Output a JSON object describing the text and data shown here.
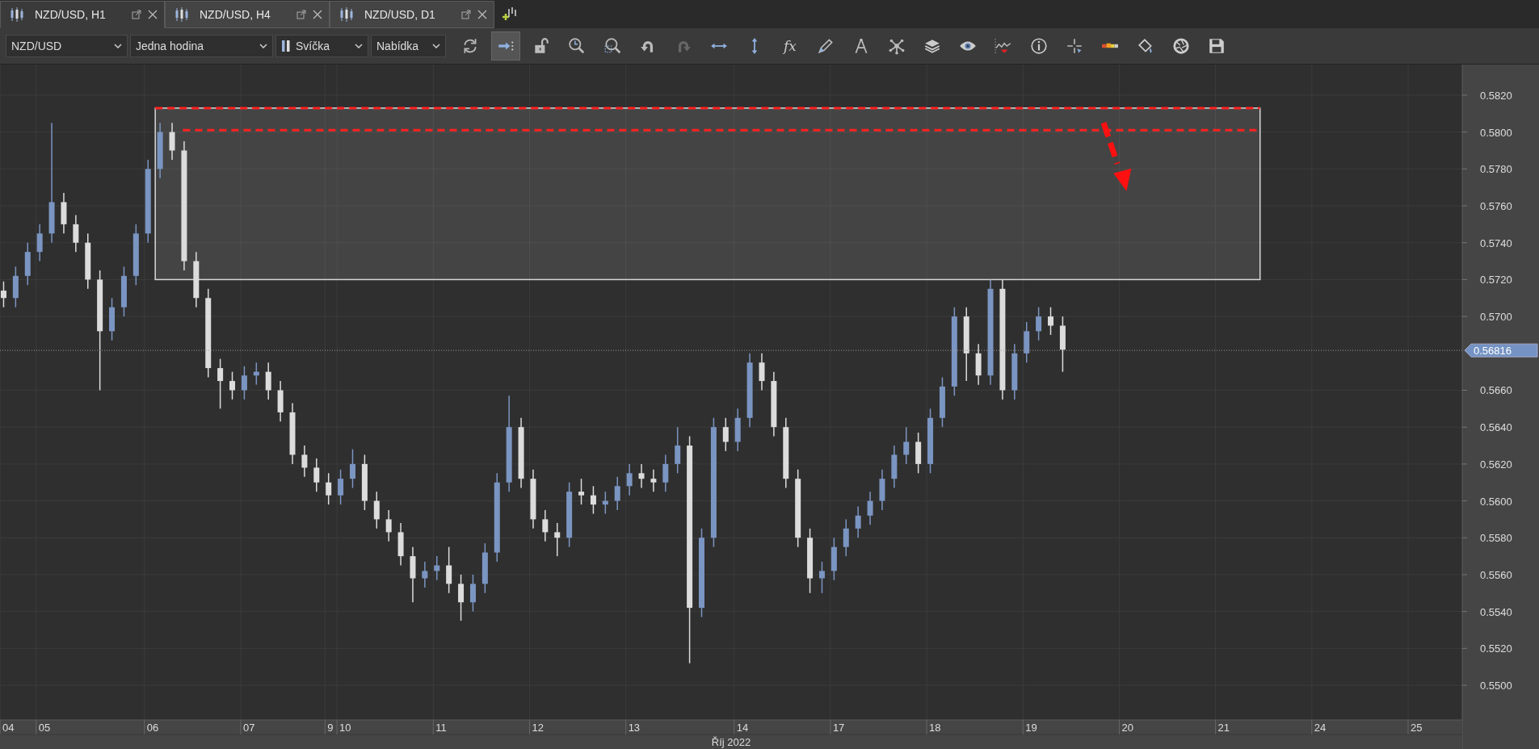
{
  "tabs": [
    {
      "label": "NZD/USD, H1",
      "selected": true
    },
    {
      "label": "NZD/USD, H4",
      "selected": false
    },
    {
      "label": "NZD/USD, D1",
      "selected": false
    }
  ],
  "toolbar": {
    "dropdowns": [
      {
        "value": "NZD/USD",
        "kind": "plain"
      },
      {
        "value": "Jedna hodina",
        "kind": "plain"
      },
      {
        "value": "Svíčka",
        "kind": "candle"
      },
      {
        "value": "Nabídka",
        "kind": "plain"
      }
    ],
    "buttons": [
      {
        "selected": false,
        "disabled": false
      },
      {
        "selected": true,
        "disabled": false
      },
      {
        "selected": false,
        "disabled": false
      },
      {
        "selected": false,
        "disabled": false
      },
      {
        "selected": false,
        "disabled": false
      },
      {
        "selected": false,
        "disabled": false
      },
      {
        "selected": false,
        "disabled": true
      },
      {
        "selected": false,
        "disabled": false
      },
      {
        "selected": false,
        "disabled": false
      },
      {
        "selected": false,
        "disabled": false,
        "label": "fx"
      },
      {
        "selected": false,
        "disabled": false
      },
      {
        "selected": false,
        "disabled": false
      },
      {
        "selected": false,
        "disabled": false
      },
      {
        "selected": false,
        "disabled": false
      },
      {
        "selected": false,
        "disabled": false
      },
      {
        "selected": false,
        "disabled": false
      },
      {
        "selected": false,
        "disabled": false
      },
      {
        "selected": false,
        "disabled": false
      },
      {
        "selected": false,
        "disabled": false
      },
      {
        "selected": false,
        "disabled": false
      },
      {
        "selected": false,
        "disabled": false
      },
      {
        "selected": false,
        "disabled": false
      }
    ]
  },
  "chart": {
    "chart_data": {
      "type": "candlestick",
      "xlabel": "Říj 2022",
      "grid": true,
      "ylim": [
        0.54812,
        0.58366
      ],
      "yticks": [
        {
          "value": 0.582,
          "label": "0.5820"
        },
        {
          "value": 0.58,
          "label": "0.5800"
        },
        {
          "value": 0.578,
          "label": "0.5780"
        },
        {
          "value": 0.576,
          "label": "0.5760"
        },
        {
          "value": 0.574,
          "label": "0.5740"
        },
        {
          "value": 0.572,
          "label": "0.5720"
        },
        {
          "value": 0.57,
          "label": "0.5700"
        },
        {
          "value": 0.566,
          "label": "0.5660"
        },
        {
          "value": 0.564,
          "label": "0.5640"
        },
        {
          "value": 0.562,
          "label": "0.5620"
        },
        {
          "value": 0.56,
          "label": "0.5600"
        },
        {
          "value": 0.558,
          "label": "0.5580"
        },
        {
          "value": 0.556,
          "label": "0.5560"
        },
        {
          "value": 0.554,
          "label": "0.5540"
        },
        {
          "value": 0.552,
          "label": "0.5520"
        },
        {
          "value": 0.55,
          "label": "0.5500"
        }
      ],
      "categories": [
        "04",
        null,
        null,
        "05",
        null,
        null,
        null,
        null,
        null,
        null,
        null,
        null,
        "06",
        null,
        null,
        null,
        null,
        null,
        null,
        null,
        "07",
        null,
        null,
        null,
        null,
        null,
        null,
        "9",
        "10",
        null,
        null,
        null,
        null,
        null,
        null,
        null,
        "11",
        null,
        null,
        null,
        null,
        null,
        null,
        null,
        "12",
        null,
        null,
        null,
        null,
        null,
        null,
        null,
        "13",
        null,
        null,
        null,
        null,
        null,
        null,
        null,
        null,
        "14",
        null,
        null,
        null,
        null,
        null,
        null,
        null,
        "17",
        null,
        null,
        null,
        null,
        null,
        null,
        null,
        "18",
        null,
        null,
        null,
        null,
        null,
        null,
        null,
        "19",
        null,
        null,
        null,
        null,
        null,
        null,
        null,
        "20",
        null,
        null,
        null,
        null,
        null,
        null,
        null,
        "21",
        null,
        null,
        null,
        null,
        null,
        null,
        null,
        "24",
        null,
        null,
        null,
        null,
        null,
        null,
        null,
        "25",
        null,
        null,
        null
      ],
      "ohlc": [
        [
          0.5714,
          0.5719,
          0.5705,
          0.571
        ],
        [
          0.571,
          0.5727,
          0.5705,
          0.5722
        ],
        [
          0.5722,
          0.574,
          0.5717,
          0.5735
        ],
        [
          0.5735,
          0.575,
          0.573,
          0.5745
        ],
        [
          0.5745,
          0.5805,
          0.574,
          0.5762
        ],
        [
          0.5762,
          0.5767,
          0.5745,
          0.575
        ],
        [
          0.575,
          0.5755,
          0.5735,
          0.574
        ],
        [
          0.574,
          0.5745,
          0.5715,
          0.572
        ],
        [
          0.572,
          0.5725,
          0.566,
          0.5692
        ],
        [
          0.5692,
          0.571,
          0.5687,
          0.5705
        ],
        [
          0.5705,
          0.5727,
          0.57,
          0.5722
        ],
        [
          0.5722,
          0.575,
          0.5717,
          0.5745
        ],
        [
          0.5745,
          0.5785,
          0.574,
          0.578
        ],
        [
          0.578,
          0.5805,
          0.5775,
          0.58
        ],
        [
          0.58,
          0.5805,
          0.5785,
          0.579
        ],
        [
          0.579,
          0.5795,
          0.5725,
          0.573
        ],
        [
          0.573,
          0.5735,
          0.5705,
          0.571
        ],
        [
          0.571,
          0.5715,
          0.5667,
          0.5672
        ],
        [
          0.5672,
          0.5677,
          0.565,
          0.5665
        ],
        [
          0.5665,
          0.567,
          0.5655,
          0.566
        ],
        [
          0.566,
          0.5673,
          0.5655,
          0.5668
        ],
        [
          0.5668,
          0.5675,
          0.5663,
          0.567
        ],
        [
          0.567,
          0.5675,
          0.5655,
          0.566
        ],
        [
          0.566,
          0.5665,
          0.5643,
          0.5648
        ],
        [
          0.5648,
          0.5653,
          0.562,
          0.5625
        ],
        [
          0.5625,
          0.563,
          0.5613,
          0.5618
        ],
        [
          0.5618,
          0.5623,
          0.5605,
          0.561
        ],
        [
          0.561,
          0.5615,
          0.5598,
          0.5603
        ],
        [
          0.5603,
          0.5617,
          0.5598,
          0.5612
        ],
        [
          0.5612,
          0.5628,
          0.5607,
          0.562
        ],
        [
          0.562,
          0.5625,
          0.5595,
          0.56
        ],
        [
          0.56,
          0.5605,
          0.5585,
          0.559
        ],
        [
          0.559,
          0.5595,
          0.5578,
          0.5583
        ],
        [
          0.5583,
          0.5588,
          0.5565,
          0.557
        ],
        [
          0.557,
          0.5575,
          0.5545,
          0.5558
        ],
        [
          0.5558,
          0.5567,
          0.5553,
          0.5562
        ],
        [
          0.5562,
          0.557,
          0.5557,
          0.5565
        ],
        [
          0.5565,
          0.5575,
          0.555,
          0.5555
        ],
        [
          0.5555,
          0.556,
          0.5535,
          0.5545
        ],
        [
          0.5545,
          0.556,
          0.554,
          0.5555
        ],
        [
          0.5555,
          0.5577,
          0.555,
          0.5572
        ],
        [
          0.5572,
          0.5615,
          0.5567,
          0.561
        ],
        [
          0.561,
          0.5657,
          0.5605,
          0.564
        ],
        [
          0.564,
          0.5645,
          0.5607,
          0.5612
        ],
        [
          0.5612,
          0.5617,
          0.5585,
          0.559
        ],
        [
          0.559,
          0.5595,
          0.5578,
          0.5583
        ],
        [
          0.5583,
          0.5588,
          0.557,
          0.558
        ],
        [
          0.558,
          0.561,
          0.5575,
          0.5605
        ],
        [
          0.5605,
          0.5612,
          0.5598,
          0.5603
        ],
        [
          0.5603,
          0.5608,
          0.5593,
          0.5598
        ],
        [
          0.5598,
          0.5605,
          0.5593,
          0.56
        ],
        [
          0.56,
          0.5613,
          0.5595,
          0.5608
        ],
        [
          0.5608,
          0.562,
          0.5603,
          0.5615
        ],
        [
          0.5615,
          0.562,
          0.5607,
          0.5612
        ],
        [
          0.5612,
          0.5617,
          0.5605,
          0.561
        ],
        [
          0.561,
          0.5625,
          0.5605,
          0.562
        ],
        [
          0.562,
          0.564,
          0.5615,
          0.563
        ],
        [
          0.563,
          0.5635,
          0.5512,
          0.5542
        ],
        [
          0.5542,
          0.5585,
          0.5537,
          0.558
        ],
        [
          0.558,
          0.5645,
          0.5575,
          0.564
        ],
        [
          0.564,
          0.5645,
          0.5627,
          0.5632
        ],
        [
          0.5632,
          0.565,
          0.5627,
          0.5645
        ],
        [
          0.5645,
          0.568,
          0.564,
          0.5675
        ],
        [
          0.5675,
          0.568,
          0.566,
          0.5665
        ],
        [
          0.5665,
          0.567,
          0.5635,
          0.564
        ],
        [
          0.564,
          0.5645,
          0.5607,
          0.5612
        ],
        [
          0.5612,
          0.5617,
          0.5575,
          0.558
        ],
        [
          0.558,
          0.5585,
          0.555,
          0.5558
        ],
        [
          0.5558,
          0.5567,
          0.555,
          0.5562
        ],
        [
          0.5562,
          0.558,
          0.5557,
          0.5575
        ],
        [
          0.5575,
          0.559,
          0.557,
          0.5585
        ],
        [
          0.5585,
          0.5597,
          0.558,
          0.5592
        ],
        [
          0.5592,
          0.5605,
          0.5587,
          0.56
        ],
        [
          0.56,
          0.5617,
          0.5595,
          0.5612
        ],
        [
          0.5612,
          0.563,
          0.5607,
          0.5625
        ],
        [
          0.5625,
          0.564,
          0.562,
          0.5632
        ],
        [
          0.5632,
          0.5637,
          0.5615,
          0.562
        ],
        [
          0.562,
          0.565,
          0.5615,
          0.5645
        ],
        [
          0.5645,
          0.5667,
          0.564,
          0.5662
        ],
        [
          0.5662,
          0.5705,
          0.5657,
          0.57
        ],
        [
          0.57,
          0.5705,
          0.5665,
          0.568
        ],
        [
          0.568,
          0.5685,
          0.5663,
          0.5668
        ],
        [
          0.5668,
          0.572,
          0.5663,
          0.5715
        ],
        [
          0.5715,
          0.572,
          0.5655,
          0.566
        ],
        [
          0.566,
          0.5685,
          0.5655,
          0.568
        ],
        [
          0.568,
          0.5697,
          0.5675,
          0.5692
        ],
        [
          0.5692,
          0.5705,
          0.5687,
          0.57
        ],
        [
          0.57,
          0.5705,
          0.569,
          0.5695
        ],
        [
          0.5695,
          0.57,
          0.567,
          0.5682
        ],
        null,
        null,
        null,
        null,
        null,
        null,
        null,
        null,
        null,
        null,
        null,
        null,
        null,
        null,
        null,
        null,
        null,
        null,
        null,
        null,
        null,
        null,
        null,
        null,
        null,
        null,
        null,
        null,
        null,
        null,
        null,
        null
      ]
    },
    "current_price_tag": "0.56816"
  }
}
